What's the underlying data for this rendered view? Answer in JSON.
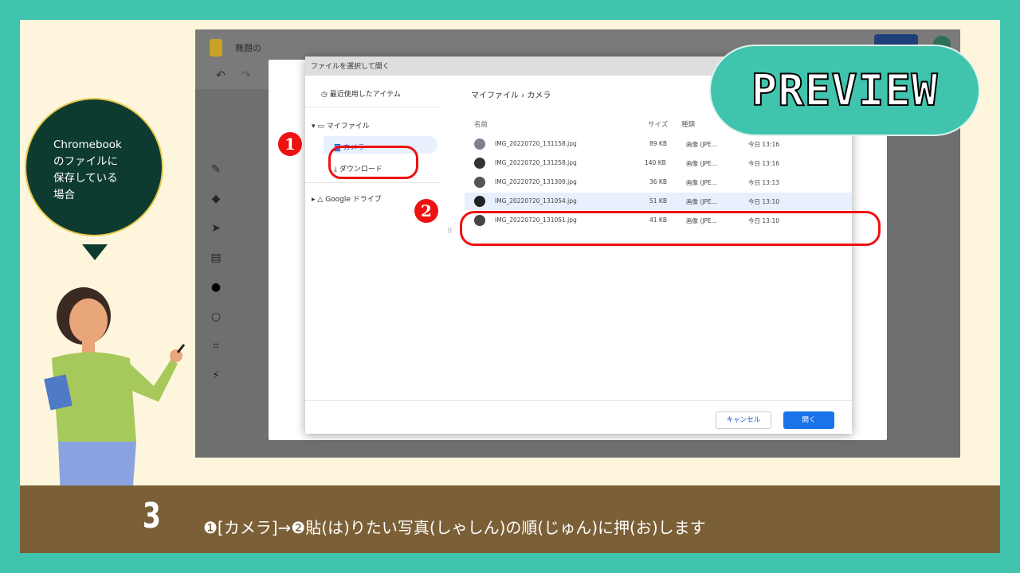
{
  "slide": {
    "step_number": "3",
    "instruction": "❶[カメラ]→❷貼(は)りたい写真(しゃしん)の順(じゅん)に押(お)します",
    "bubble_lines": [
      "Chromebook",
      "のファイルに",
      "保存している",
      "場合"
    ],
    "preview_label": "PREVIEW",
    "mark1": "1",
    "mark2": "2"
  },
  "app": {
    "doc_title": "無題の",
    "undo_icon": "undo-icon",
    "redo_icon": "redo-icon"
  },
  "dialog": {
    "title": "ファイルを選択して開く",
    "nav": {
      "recent": "最近使用したアイテム",
      "my_files": "マイファイル",
      "camera": "カメラ",
      "downloads": "ダウンロード",
      "drive": "Google ドライブ"
    },
    "breadcrumb": "マイファイル  ›  カメラ",
    "columns": {
      "name": "名前",
      "size": "サイズ",
      "type": "種類"
    },
    "files": [
      {
        "name": "IMG_20220720_131158.jpg",
        "size": "89 KB",
        "type": "画像 (JPE...",
        "date": "今日 13:16"
      },
      {
        "name": "IMG_20220720_131258.jpg",
        "size": "140 KB",
        "type": "画像 (JPE...",
        "date": "今日 13:16"
      },
      {
        "name": "IMG_20220720_131309.jpg",
        "size": "36 KB",
        "type": "画像 (JPE...",
        "date": "今日 13:13"
      },
      {
        "name": "IMG_20220720_131054.jpg",
        "size": "51 KB",
        "type": "画像 (JPE...",
        "date": "今日 13:10"
      },
      {
        "name": "IMG_20220720_131051.jpg",
        "size": "41 KB",
        "type": "画像 (JPE...",
        "date": "今日 13:10"
      }
    ],
    "cancel": "キャンセル",
    "open": "開く"
  },
  "colors": {
    "frame": "#40c4ae",
    "slide_bg": "#fdf6dd",
    "footer": "#7b5f37",
    "bubble": "#0e3b30",
    "highlight": "#e11111"
  }
}
